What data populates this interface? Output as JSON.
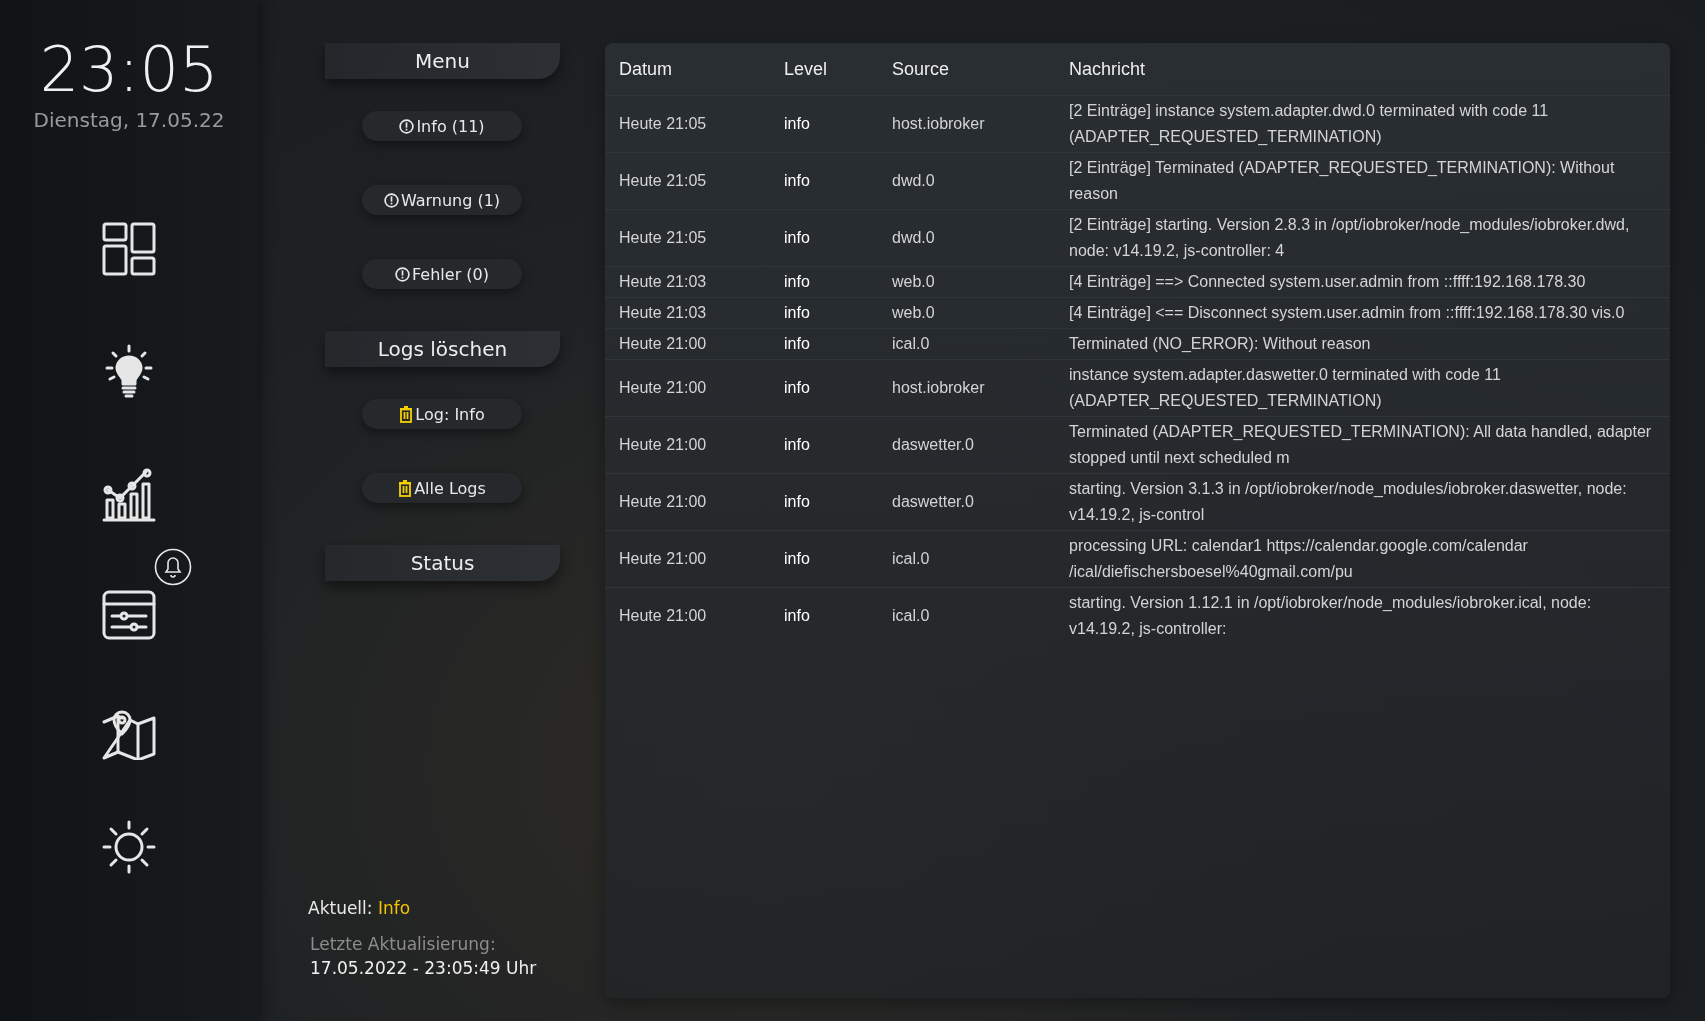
{
  "clock": {
    "time": "23:05",
    "date": "Dienstag, 17.05.22"
  },
  "menu": [
    {
      "kind": "header",
      "label": "Menu"
    },
    {
      "kind": "filter",
      "label": "Info (11)"
    },
    {
      "kind": "filter",
      "label": "Warnung (1)"
    },
    {
      "kind": "filter",
      "label": "Fehler (0)"
    },
    {
      "kind": "header",
      "label": "Logs löschen"
    },
    {
      "kind": "delete",
      "label": "Log: Info"
    },
    {
      "kind": "delete",
      "label": "Alle Logs"
    },
    {
      "kind": "header",
      "label": "Status"
    }
  ],
  "status": {
    "current_label": "Aktuell:",
    "current_value": "Info",
    "updated_label": "Letzte Aktualisierung:",
    "updated_value": "17.05.2022 - 23:05:49 Uhr"
  },
  "table": {
    "columns": [
      "Datum",
      "Level",
      "Source",
      "Nachricht"
    ],
    "rows": [
      {
        "date": "Heute 21:05",
        "level": "info",
        "source": "host.iobroker",
        "message": "[2 Einträge] instance system.adapter.dwd.0 terminated with code 11 (ADAPTER_REQUESTED_TERMINATION)"
      },
      {
        "date": "Heute 21:05",
        "level": "info",
        "source": "dwd.0",
        "message": "[2 Einträge] Terminated (ADAPTER_REQUESTED_TERMINATION): Without reason"
      },
      {
        "date": "Heute 21:05",
        "level": "info",
        "source": "dwd.0",
        "message": "[2 Einträge] starting. Version 2.8.3 in /opt/iobroker/node_modules/iobroker.dwd, node: v14.19.2, js-controller: 4"
      },
      {
        "date": "Heute 21:03",
        "level": "info",
        "source": "web.0",
        "message": "[4 Einträge] ==> Connected system.user.admin from ::ffff:192.168.178.30"
      },
      {
        "date": "Heute 21:03",
        "level": "info",
        "source": "web.0",
        "message": "[4 Einträge] <== Disconnect system.user.admin from ::ffff:192.168.178.30 vis.0"
      },
      {
        "date": "Heute 21:00",
        "level": "info",
        "source": "ical.0",
        "message": "Terminated (NO_ERROR): Without reason"
      },
      {
        "date": "Heute 21:00",
        "level": "info",
        "source": "host.iobroker",
        "message": "instance system.adapter.daswetter.0 terminated with code 11 (ADAPTER_REQUESTED_TERMINATION)"
      },
      {
        "date": "Heute 21:00",
        "level": "info",
        "source": "daswetter.0",
        "message": "Terminated (ADAPTER_REQUESTED_TERMINATION): All data handled, adapter stopped until next scheduled m"
      },
      {
        "date": "Heute 21:00",
        "level": "info",
        "source": "daswetter.0",
        "message": "starting. Version 3.1.3 in /opt/iobroker/node_modules/iobroker.daswetter, node: v14.19.2, js-control"
      },
      {
        "date": "Heute 21:00",
        "level": "info",
        "source": "ical.0",
        "message": "processing URL: calendar1 https://calendar.google.com/calendar /ical/diefischersboesel%40gmail.com/pu"
      },
      {
        "date": "Heute 21:00",
        "level": "info",
        "source": "ical.0",
        "message": "starting. Version 1.12.1 in /opt/iobroker/node_modules/iobroker.ical, node: v14.19.2, js-controller:"
      }
    ]
  }
}
